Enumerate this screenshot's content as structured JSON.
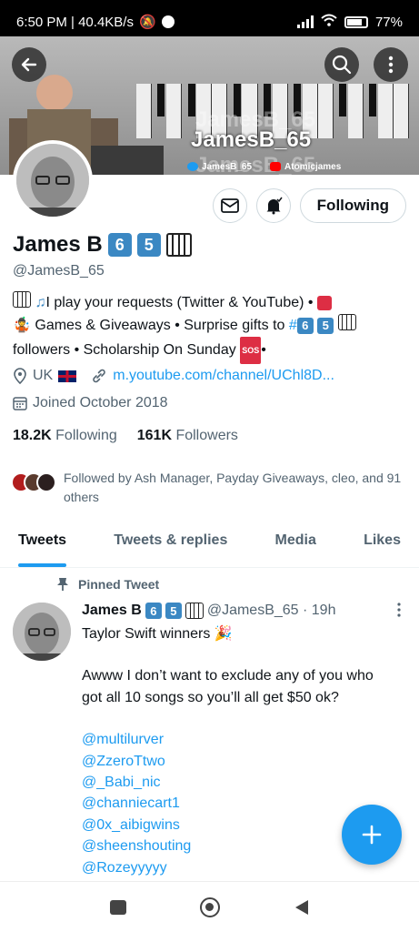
{
  "status_bar": {
    "time_speed": "6:50 PM | 40.4KB/s",
    "battery": "77%"
  },
  "banner": {
    "title": "JamesB_65",
    "twitter_handle": "JamesB_65",
    "youtube_handle": "Atomicjames"
  },
  "profile": {
    "name": "James B",
    "name_digit_1": "6",
    "name_digit_2": "5",
    "handle": "@JamesB_65",
    "follow_label": "Following",
    "bio_line1": "I play your requests (Twitter & YouTube) •",
    "bio_line2a": "Games & Giveaways • Surprise gifts to",
    "bio_hashtag": "#",
    "bio_line3": "followers • Scholarship On Sunday",
    "bio_sos": "SOS",
    "location": "UK",
    "link": "m.youtube.com/channel/UChl8D...",
    "joined": "Joined October 2018",
    "following_count": "18.2K",
    "following_label": "Following",
    "followers_count": "161K",
    "followers_label": "Followers",
    "followed_by": "Followed by Ash Manager, Payday Giveaways, cleo, and 91 others"
  },
  "tabs": [
    "Tweets",
    "Tweets & replies",
    "Media",
    "Likes"
  ],
  "tweet": {
    "pinned_label": "Pinned Tweet",
    "author": "James B",
    "handle_time": "@JamesB_65 · 19h",
    "line1": "Taylor Swift winners",
    "para": "Awww I don’t want to exclude any of you who got all 10 songs so you’ll all get $50 ok?",
    "mentions": [
      "@multilurver",
      "@ZzeroTtwo",
      "@_Babi_nic",
      "@channiecart1",
      "@0x_aibigwins",
      "@sheenshouting",
      "@Rozeyyyyy"
    ]
  },
  "icons": {
    "back": "arrow-left-icon",
    "search": "search-icon",
    "more": "more-vertical-icon",
    "message": "envelope-icon",
    "notify": "bell-icon",
    "compose": "plus-icon"
  },
  "colors": {
    "accent": "#1d9bf0",
    "keycap": "#3b88c3"
  }
}
